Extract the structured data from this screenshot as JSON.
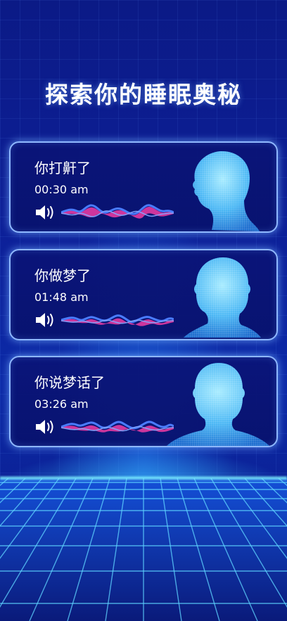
{
  "title": "探索你的睡眠奥秘",
  "cards": [
    {
      "label": "你打鼾了",
      "time": "00:30 am"
    },
    {
      "label": "你做梦了",
      "time": "01:48 am"
    },
    {
      "label": "你说梦话了",
      "time": "03:26 am"
    }
  ],
  "icons": {
    "speaker": "speaker-icon",
    "wave": "sound-wave-icon",
    "head": "head-scan-icon"
  },
  "colors": {
    "background": "#0d1f97",
    "card_border": "#8fb8ff",
    "wave_blue": "#3b6cff",
    "wave_pink": "#ff3fa8",
    "head": "#5cc8ff"
  }
}
